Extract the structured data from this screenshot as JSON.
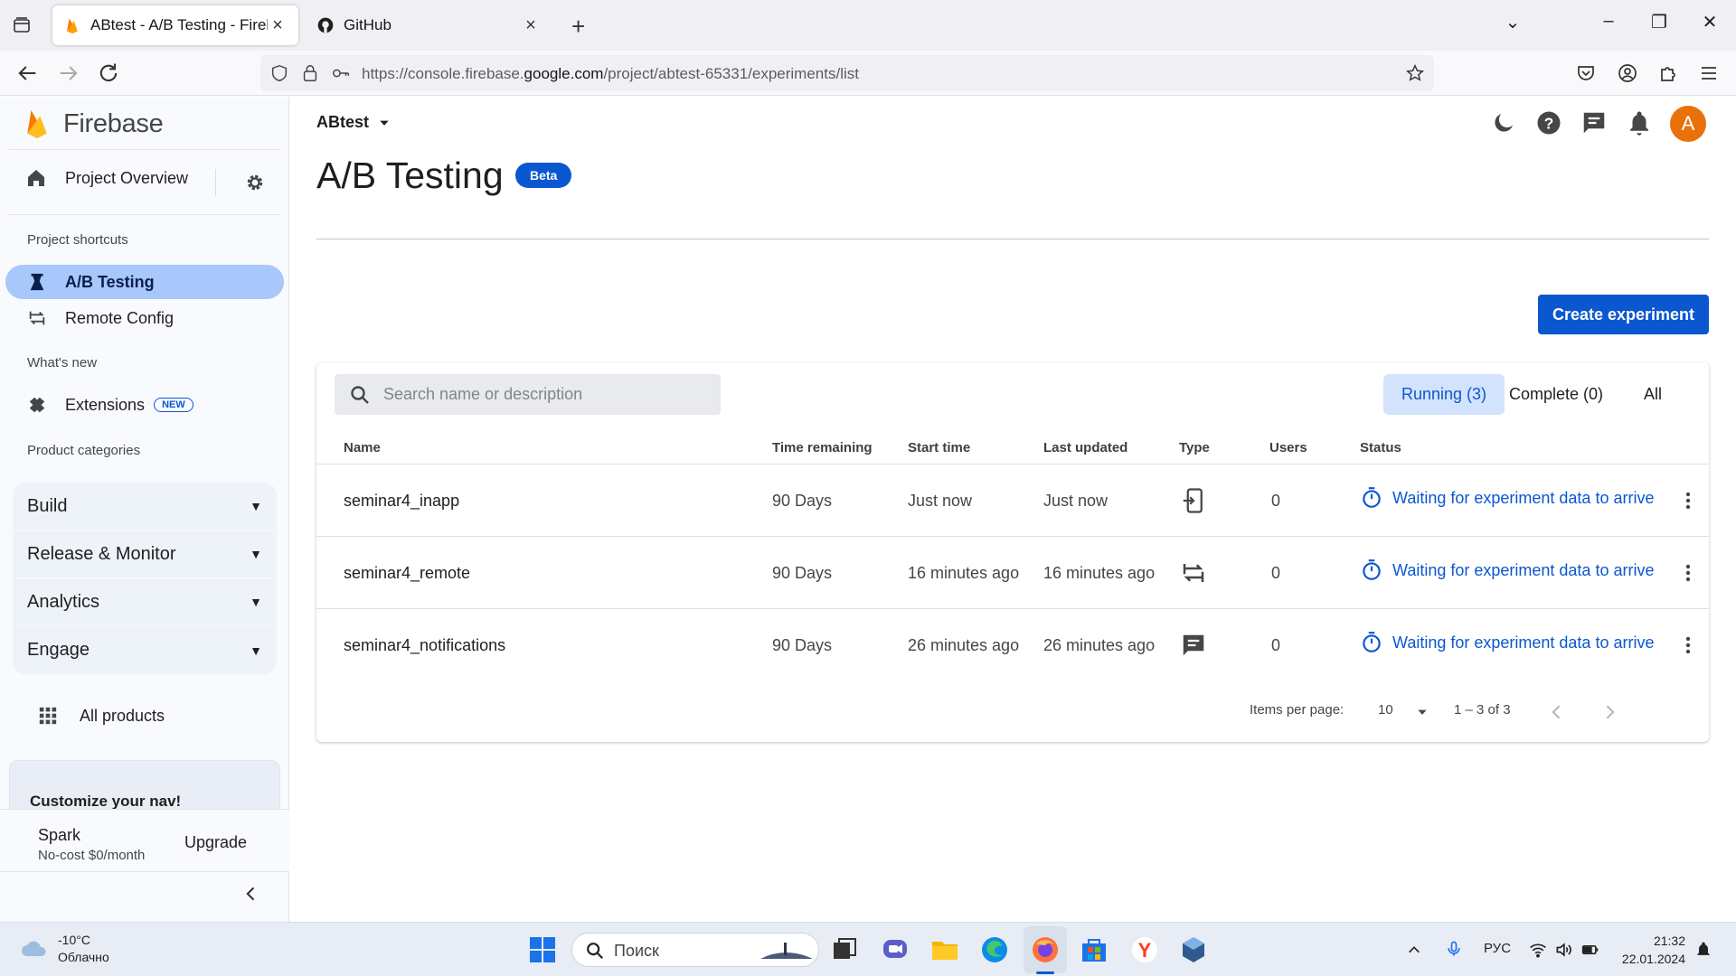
{
  "browser": {
    "tabs": [
      {
        "title": "ABtest - A/B Testing - Firebase Console",
        "active": true
      },
      {
        "title": "GitHub",
        "active": false
      }
    ],
    "url_prefix": "https://console.firebase.",
    "url_domain": "google.com",
    "url_path": "/project/abtest-65331/experiments/list"
  },
  "sidebar": {
    "brand": "Firebase",
    "project_overview": "Project Overview",
    "shortcuts_heading": "Project shortcuts",
    "shortcuts": [
      {
        "label": "A/B Testing",
        "icon": "flask-icon",
        "active": true
      },
      {
        "label": "Remote Config",
        "icon": "remote-config-icon",
        "active": false
      }
    ],
    "whats_new_heading": "What's new",
    "extensions_label": "Extensions",
    "extensions_badge": "NEW",
    "categories_heading": "Product categories",
    "categories": [
      "Build",
      "Release & Monitor",
      "Analytics",
      "Engage"
    ],
    "all_products": "All products",
    "customize_text": "Customize your nav!",
    "plan_name": "Spark",
    "plan_desc": "No-cost $0/month",
    "upgrade_label": "Upgrade"
  },
  "main": {
    "project_name": "ABtest",
    "page_title": "A/B Testing",
    "beta_badge": "Beta",
    "create_button": "Create experiment",
    "search_placeholder": "Search name or description",
    "filters": [
      {
        "label": "Running (3)",
        "active": true
      },
      {
        "label": "Complete (0)",
        "active": false
      },
      {
        "label": "All",
        "active": false
      }
    ],
    "columns": [
      "Name",
      "Time remaining",
      "Start time",
      "Last updated",
      "Type",
      "Users",
      "Status"
    ],
    "rows": [
      {
        "name": "seminar4_inapp",
        "time_remaining": "90 Days",
        "start_time": "Just now",
        "last_updated": "Just now",
        "type": "in-app-messaging-icon",
        "users": "0",
        "status": "Waiting for experiment data to arrive"
      },
      {
        "name": "seminar4_remote",
        "time_remaining": "90 Days",
        "start_time": "16 minutes ago",
        "last_updated": "16 minutes ago",
        "type": "remote-config-icon",
        "users": "0",
        "status": "Waiting for experiment data to arrive"
      },
      {
        "name": "seminar4_notifications",
        "time_remaining": "90 Days",
        "start_time": "26 minutes ago",
        "last_updated": "26 minutes ago",
        "type": "notifications-icon",
        "users": "0",
        "status": "Waiting for experiment data to arrive"
      }
    ],
    "pagination": {
      "items_per_page_label": "Items per page:",
      "items_per_page": "10",
      "range": "1 – 3 of 3"
    },
    "avatar_letter": "A"
  },
  "taskbar": {
    "temperature": "-10°C",
    "weather_desc": "Облачно",
    "search_placeholder": "Поиск",
    "language": "РУС",
    "time": "21:32",
    "date": "22.01.2024"
  },
  "colors": {
    "primary": "#0b57d0",
    "active_nav": "#a8c7fa",
    "active_filter": "#d3e3fd",
    "avatar": "#e8710a"
  }
}
